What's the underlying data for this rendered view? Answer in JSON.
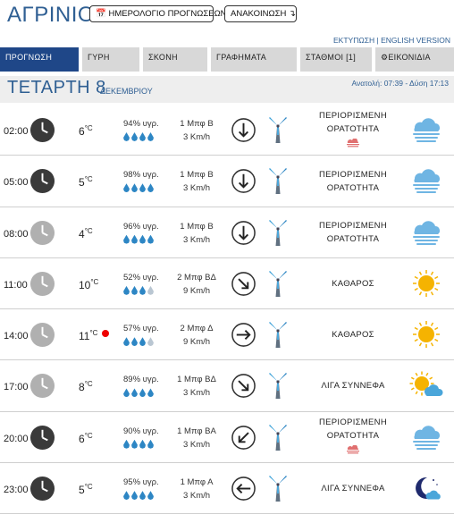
{
  "header": {
    "city": "ΑΓΡΙΝΙΟ",
    "calendar_button": "ΗΜΕΡΟΛΟΓΙΟ ΠΡΟΓΝΩΣΕΩΝ",
    "announcements_button": "ΑΝΑΚΟΙΝΩΣΗ",
    "print_link": "ΕΚΤΥΠΩΣΗ",
    "separator": "|",
    "english_link": "ENGLISH VERSION"
  },
  "tabs": [
    {
      "label": "ΠΡΟΓΝΩΣΗ",
      "active": true
    },
    {
      "label": "ΓΥΡΗ",
      "active": false
    },
    {
      "label": "ΣΚΟΝΗ",
      "active": false
    },
    {
      "label": "ΓΡΑΦΗΜΑΤΑ",
      "active": false
    },
    {
      "label": "ΣΤΑΘΜΟΙ [1]",
      "active": false
    },
    {
      "label": "ΕΙΚΟΝΙΔΙΑ",
      "active": false
    }
  ],
  "day": {
    "name": "ΤΕΤΑΡΤΗ 8",
    "month": "ΔΕΚΕΜΒΡΙΟΥ",
    "sun": "Ανατολή: 07:39 - Δύση 17:13"
  },
  "rows": [
    {
      "time": "02:00",
      "clock": "night",
      "temp": "6",
      "unit": "°C",
      "alert": false,
      "humidity": "94% υγρ.",
      "drops": 4,
      "wind_speed": "1 Μπφ Β",
      "wind_kmh": "3 Km/h",
      "arrow": "down",
      "cond": "ΠΕΡΙΟΡΙΣΜΕΝΗ ΟΡΑΤΟΤΗΤΑ",
      "fog_mark": true,
      "icon": "fog-icon"
    },
    {
      "time": "05:00",
      "clock": "night",
      "temp": "5",
      "unit": "°C",
      "alert": false,
      "humidity": "98% υγρ.",
      "drops": 4,
      "wind_speed": "1 Μπφ Β",
      "wind_kmh": "3 Km/h",
      "arrow": "down",
      "cond": "ΠΕΡΙΟΡΙΣΜΕΝΗ ΟΡΑΤΟΤΗΤΑ",
      "fog_mark": false,
      "icon": "fog-icon"
    },
    {
      "time": "08:00",
      "clock": "day",
      "temp": "4",
      "unit": "°C",
      "alert": false,
      "humidity": "96% υγρ.",
      "drops": 4,
      "wind_speed": "1 Μπφ Β",
      "wind_kmh": "3 Km/h",
      "arrow": "down",
      "cond": "ΠΕΡΙΟΡΙΣΜΕΝΗ ΟΡΑΤΟΤΗΤΑ",
      "fog_mark": false,
      "icon": "fog-icon"
    },
    {
      "time": "11:00",
      "clock": "day",
      "temp": "10",
      "unit": "°C",
      "alert": false,
      "humidity": "52% υγρ.",
      "drops": 3,
      "wind_speed": "2 Μπφ ΒΔ",
      "wind_kmh": "9 Km/h",
      "arrow": "down-right",
      "cond": "ΚΑΘΑΡΟΣ",
      "fog_mark": false,
      "icon": "sun-icon"
    },
    {
      "time": "14:00",
      "clock": "day",
      "temp": "11",
      "unit": "°C",
      "alert": true,
      "humidity": "57% υγρ.",
      "drops": 3,
      "wind_speed": "2 Μπφ Δ",
      "wind_kmh": "9 Km/h",
      "arrow": "right",
      "cond": "ΚΑΘΑΡΟΣ",
      "fog_mark": false,
      "icon": "sun-icon"
    },
    {
      "time": "17:00",
      "clock": "day",
      "temp": "8",
      "unit": "°C",
      "alert": false,
      "humidity": "89% υγρ.",
      "drops": 4,
      "wind_speed": "1 Μπφ ΒΔ",
      "wind_kmh": "3 Km/h",
      "arrow": "down-right",
      "cond": "ΛΙΓΑ ΣΥΝΝΕΦΑ",
      "fog_mark": false,
      "icon": "sun-cloud-icon"
    },
    {
      "time": "20:00",
      "clock": "night",
      "temp": "6",
      "unit": "°C",
      "alert": false,
      "humidity": "90% υγρ.",
      "drops": 4,
      "wind_speed": "1 Μπφ ΒΑ",
      "wind_kmh": "3 Km/h",
      "arrow": "down-left",
      "cond": "ΠΕΡΙΟΡΙΣΜΕΝΗ ΟΡΑΤΟΤΗΤΑ",
      "fog_mark": true,
      "icon": "fog-icon"
    },
    {
      "time": "23:00",
      "clock": "night",
      "temp": "5",
      "unit": "°C",
      "alert": false,
      "humidity": "95% υγρ.",
      "drops": 4,
      "wind_speed": "1 Μπφ Α",
      "wind_kmh": "3 Km/h",
      "arrow": "left",
      "cond": "ΛΙΓΑ ΣΥΝΝΕΦΑ",
      "fog_mark": false,
      "icon": "moon-cloud-icon"
    }
  ],
  "colors": {
    "brand": "#2f5f93",
    "tab_active": "#1f4788",
    "tab_inactive": "#d8d8d8",
    "drop_full": "#2d86c4",
    "drop_empty": "#b9c6d2",
    "alert": "#e00000",
    "sun": "#f5b301",
    "fog": "#6fb5e3"
  }
}
